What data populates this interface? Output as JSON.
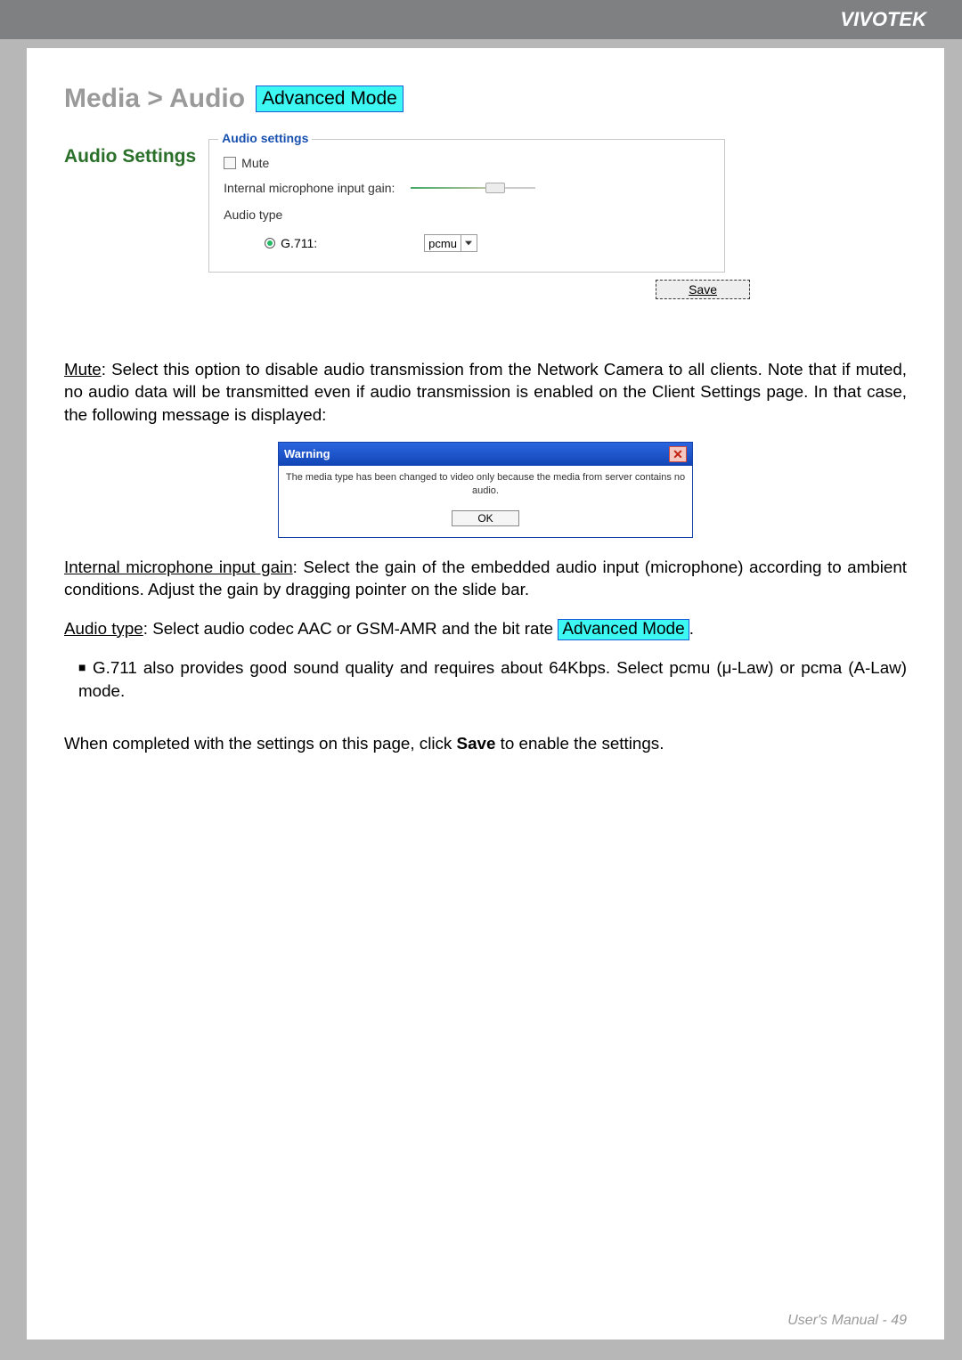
{
  "header": {
    "brand": "VIVOTEK"
  },
  "breadcrumb": "Media > Audio",
  "mode_badge": "Advanced Mode",
  "section_heading": "Audio Settings",
  "form": {
    "legend": "Audio settings",
    "mute_label": "Mute",
    "gain_label": "Internal microphone input gain:",
    "audio_type_label": "Audio type",
    "codec": {
      "name": "G.711:",
      "selected": "pcmu"
    },
    "save_label": "Save"
  },
  "dialog": {
    "title": "Warning",
    "message": "The media type has been changed to video only because the media from server contains no audio.",
    "ok": "OK"
  },
  "body": {
    "mute_heading": "Mute",
    "mute_text": ": Select this option to disable audio transmission from the Network Camera to all clients. Note that if muted, no audio data will be transmitted even if audio transmission is enabled on the Client Settings page. In that case, the following message is displayed:",
    "gain_heading": "Internal microphone input gain",
    "gain_text": ": Select the gain of the embedded audio input (microphone) according to ambient conditions. Adjust the gain by dragging pointer on the slide bar.",
    "audio_type_heading": "Audio type",
    "audio_type_text_pre": ": Select audio codec AAC or GSM-AMR and the bit rate ",
    "audio_type_text_post": ".",
    "bullet_g711": "G.711 also provides good sound quality and requires about 64Kbps. Select pcmu (μ-Law) or pcma (A-Law) mode.",
    "save_note_pre": "When completed with the settings on this page, click ",
    "save_note_bold": "Save",
    "save_note_post": " to enable the settings."
  },
  "footer": "User's Manual - 49"
}
